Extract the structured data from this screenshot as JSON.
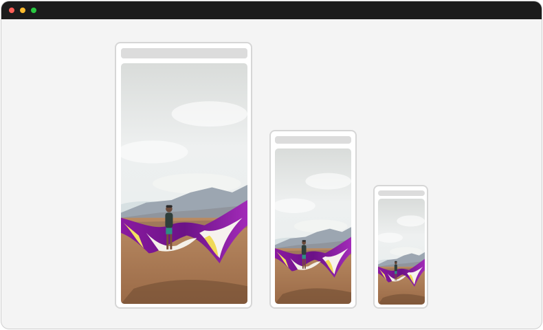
{
  "window": {
    "controls": [
      "close",
      "minimize",
      "zoom"
    ],
    "colors": {
      "close": "#ff5f57",
      "minimize": "#febc2e",
      "zoom": "#28c840",
      "titlebar": "#1c1c1c",
      "background": "#f4f4f4"
    }
  },
  "previews": [
    {
      "name": "large",
      "image": "kite-beach-photo"
    },
    {
      "name": "medium",
      "image": "kite-beach-photo"
    },
    {
      "name": "small",
      "image": "kite-beach-photo"
    }
  ]
}
